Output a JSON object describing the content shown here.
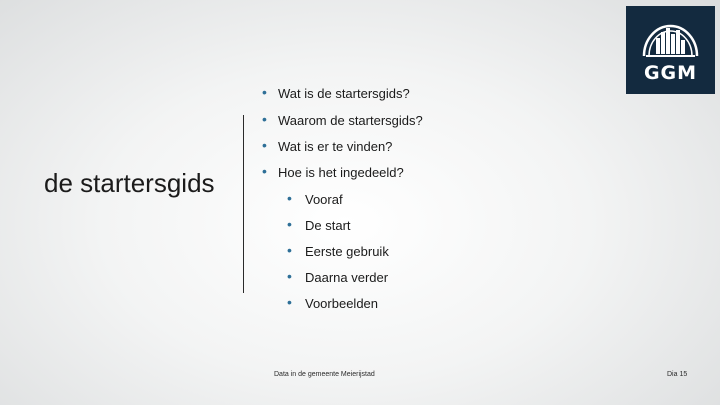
{
  "slide": {
    "title": "de startersgids",
    "bullets": [
      "Wat is de startersgids?",
      "Waarom de startersgids?",
      "Wat is er te vinden?",
      "Hoe is het ingedeeld?"
    ],
    "sub_bullets": [
      "Vooraf",
      "De start",
      "Eerste gebruik",
      "Daarna verder",
      "Voorbeelden"
    ],
    "footer_text": "Data in de gemeente Meierijstad",
    "slide_number": "Dia 15"
  },
  "logo": {
    "text": "GGM",
    "background_color": "#132a3f",
    "icon": "city-skyline-arch-icon"
  },
  "colors": {
    "bullet": "#2e6f97",
    "text": "#1b1b1b"
  }
}
